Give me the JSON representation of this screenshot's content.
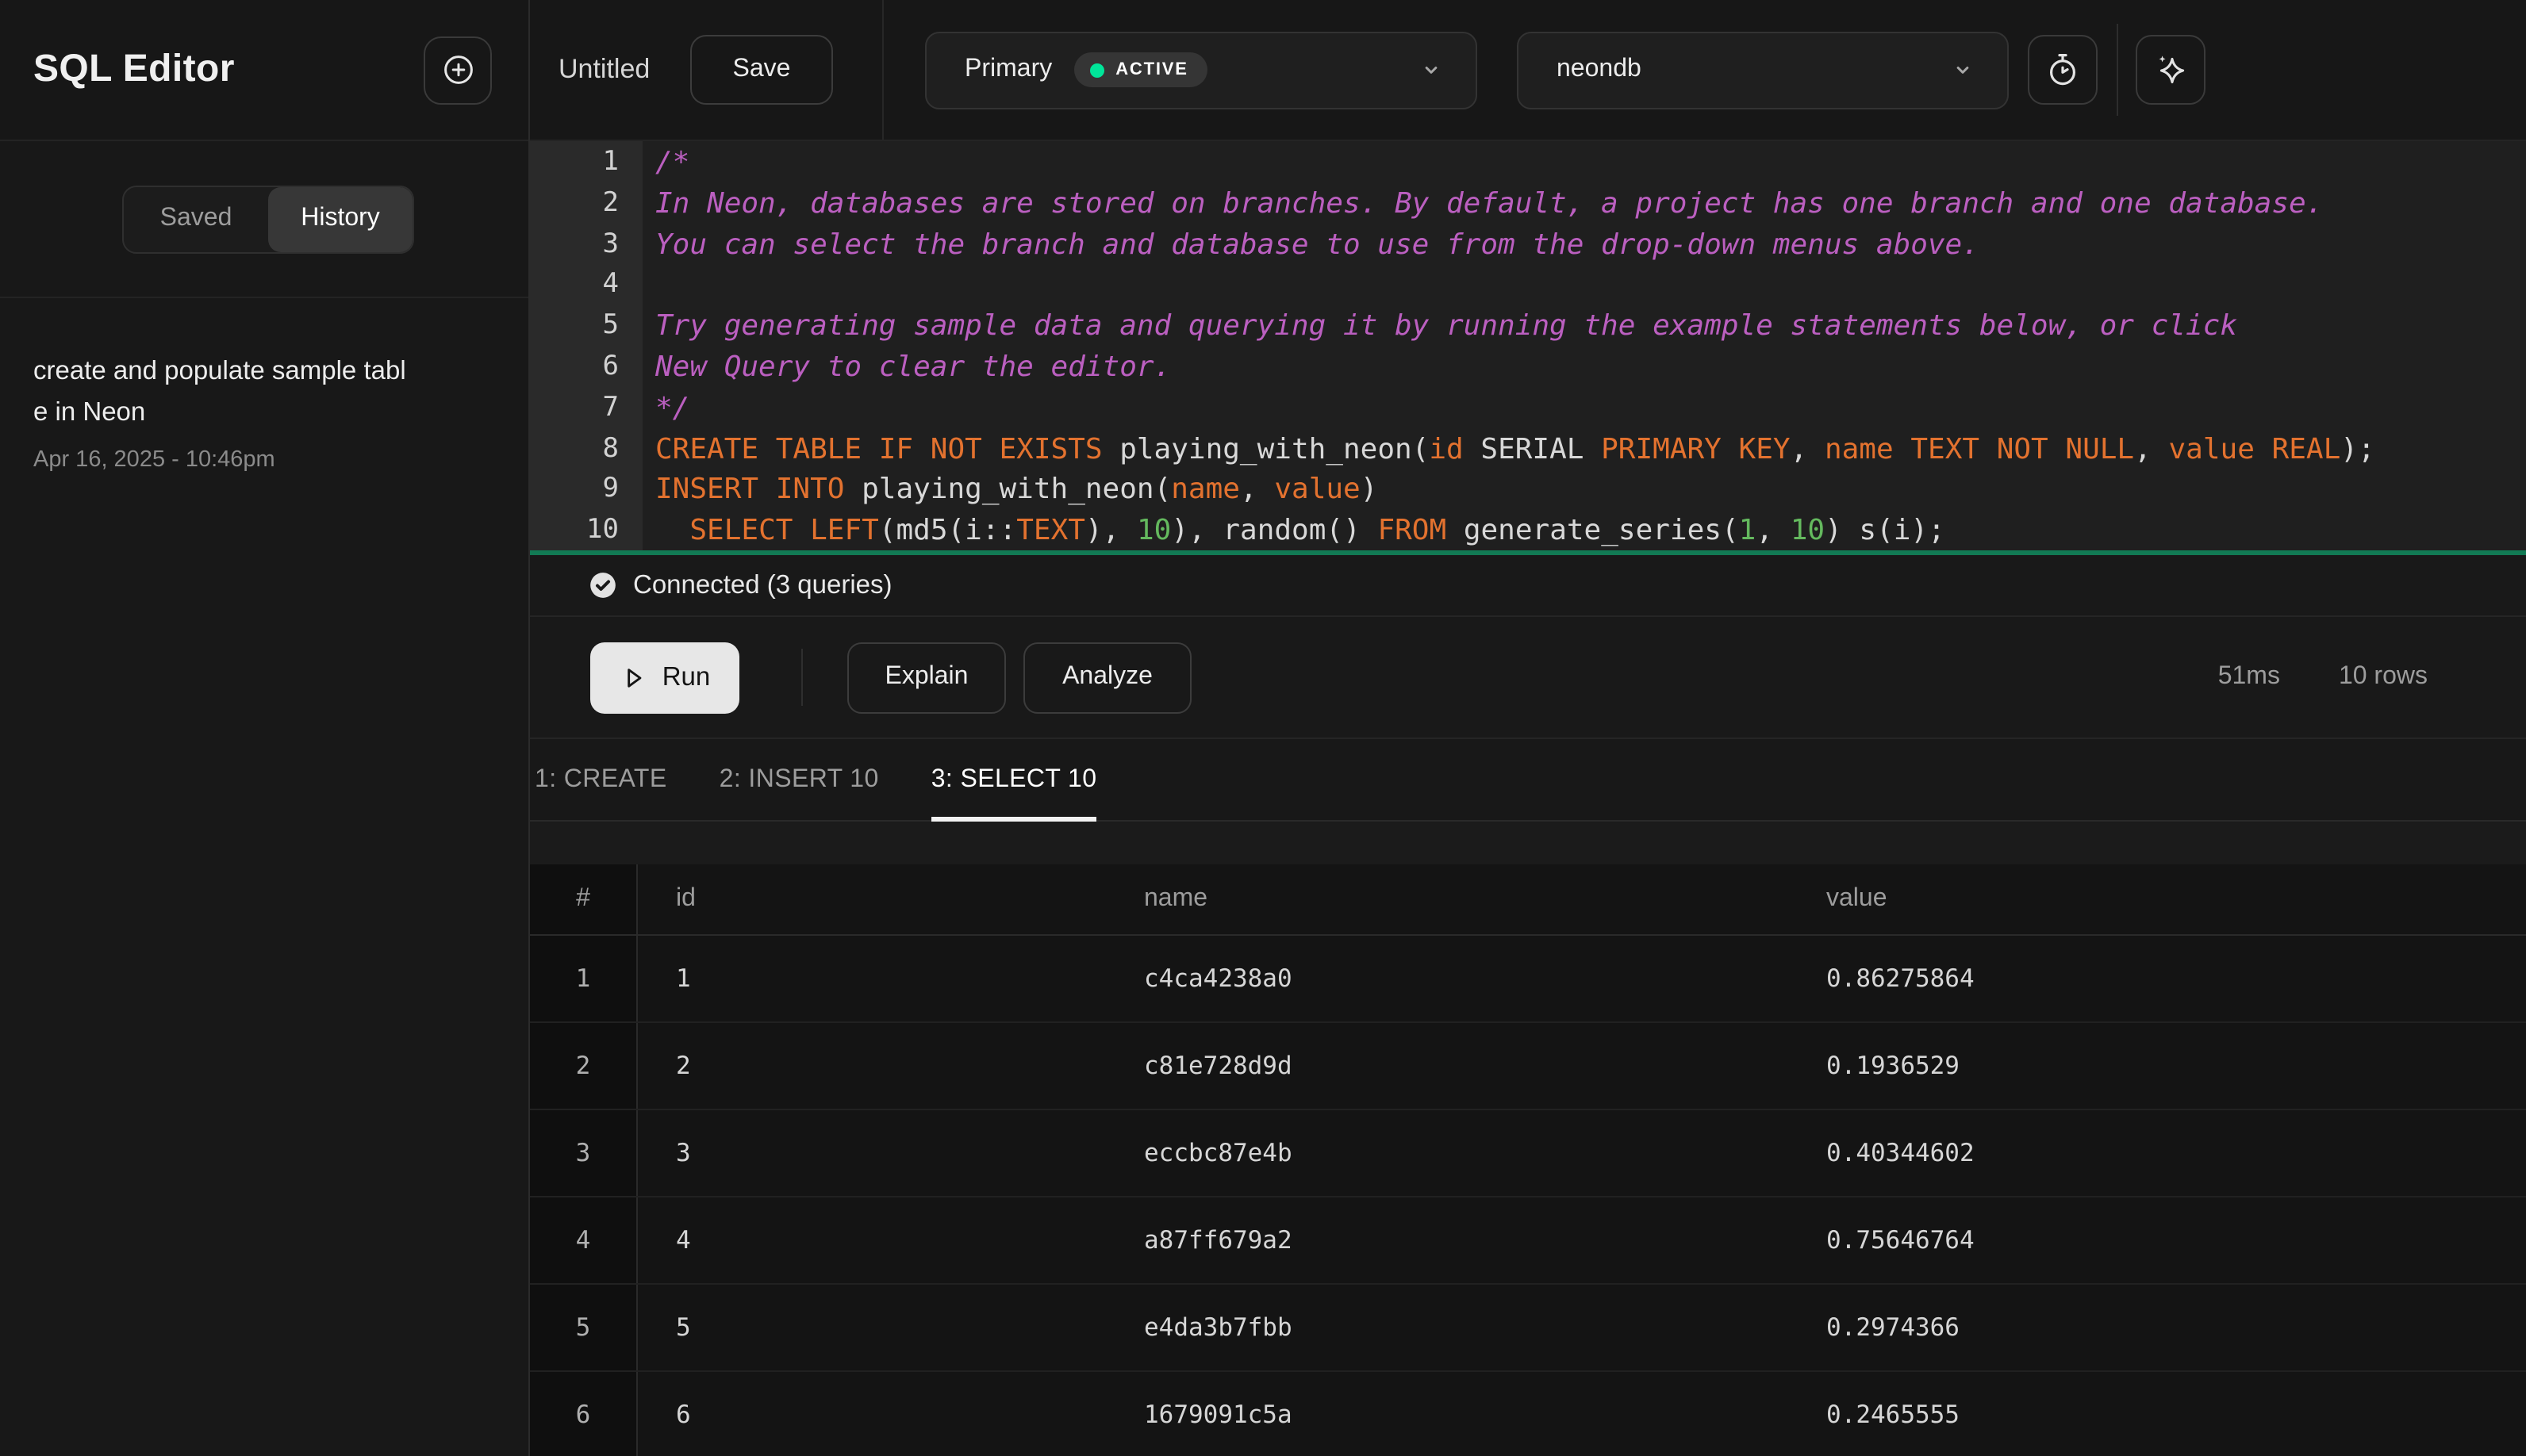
{
  "sidebar": {
    "title": "SQL Editor",
    "tabs": [
      {
        "label": "Saved",
        "active": false
      },
      {
        "label": "History",
        "active": true
      }
    ],
    "history": [
      {
        "title": "create and populate sample table in Neon",
        "timestamp": "Apr 16, 2025 - 10:46pm"
      }
    ]
  },
  "topbar": {
    "file_name": "Untitled",
    "save_label": "Save",
    "branch": {
      "name": "Primary",
      "status": "ACTIVE"
    },
    "database": {
      "name": "neondb"
    }
  },
  "editor": {
    "lines": [
      [
        [
          "c",
          "/*"
        ]
      ],
      [
        [
          "c",
          "In Neon, databases are stored on branches. By default, a project has one branch and one database."
        ]
      ],
      [
        [
          "c",
          "You can select the branch and database to use from the drop-down menus above."
        ]
      ],
      [],
      [
        [
          "c",
          "Try generating sample data and querying it by running the example statements below, or click"
        ]
      ],
      [
        [
          "c",
          "New Query to clear the editor."
        ]
      ],
      [
        [
          "c",
          "*/"
        ]
      ],
      [
        [
          "k",
          "CREATE TABLE IF NOT EXISTS"
        ],
        [
          "p",
          " playing_with_neon("
        ],
        [
          "k",
          "id"
        ],
        [
          "p",
          " SERIAL "
        ],
        [
          "k",
          "PRIMARY KEY"
        ],
        [
          "p",
          ", "
        ],
        [
          "k",
          "name"
        ],
        [
          "p",
          " "
        ],
        [
          "k",
          "TEXT NOT NULL"
        ],
        [
          "p",
          ", "
        ],
        [
          "k",
          "value"
        ],
        [
          "p",
          " "
        ],
        [
          "k",
          "REAL"
        ],
        [
          "p",
          ");"
        ]
      ],
      [
        [
          "k",
          "INSERT INTO"
        ],
        [
          "p",
          " playing_with_neon("
        ],
        [
          "k",
          "name"
        ],
        [
          "p",
          ", "
        ],
        [
          "k",
          "value"
        ],
        [
          "p",
          ")"
        ]
      ],
      [
        [
          "p",
          "  "
        ],
        [
          "k",
          "SELECT LEFT"
        ],
        [
          "p",
          "(md5(i::"
        ],
        [
          "k",
          "TEXT"
        ],
        [
          "p",
          "), "
        ],
        [
          "n",
          "10"
        ],
        [
          "p",
          "), random() "
        ],
        [
          "k",
          "FROM"
        ],
        [
          "p",
          " generate_series("
        ],
        [
          "n",
          "1"
        ],
        [
          "p",
          ", "
        ],
        [
          "n",
          "10"
        ],
        [
          "p",
          ") s(i);"
        ]
      ]
    ]
  },
  "status": {
    "text": "Connected (3 queries)"
  },
  "actions": {
    "run_label": "Run",
    "explain_label": "Explain",
    "analyze_label": "Analyze",
    "duration": "51ms",
    "row_count": "10 rows"
  },
  "results": {
    "tabs": [
      {
        "label": "1: CREATE",
        "active": false
      },
      {
        "label": "2: INSERT 10",
        "active": false
      },
      {
        "label": "3: SELECT 10",
        "active": true
      }
    ],
    "table": {
      "columns": [
        "#",
        "id",
        "name",
        "value"
      ],
      "rows": [
        [
          "1",
          "1",
          "c4ca4238a0",
          "0.86275864"
        ],
        [
          "2",
          "2",
          "c81e728d9d",
          "0.1936529"
        ],
        [
          "3",
          "3",
          "eccbc87e4b",
          "0.40344602"
        ],
        [
          "4",
          "4",
          "a87ff679a2",
          "0.75646764"
        ],
        [
          "5",
          "5",
          "e4da3b7fbb",
          "0.2974366"
        ],
        [
          "6",
          "6",
          "1679091c5a",
          "0.2465555"
        ]
      ]
    }
  },
  "colors": {
    "accent_green": "#00e599",
    "statement_highlight": "#127a54",
    "syntax_keyword": "#e3722f",
    "syntax_comment": "#bb5fc0",
    "syntax_number": "#64b95e"
  }
}
